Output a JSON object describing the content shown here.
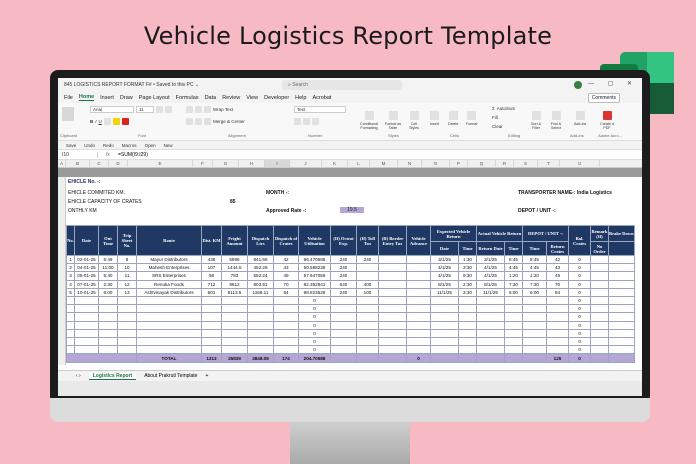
{
  "page_title": "Vehicle Logistics Report Template",
  "window": {
    "title": "845 LOGISTICS REPORT FORMAT F# • Saved to this PC ⌄",
    "search_placeholder": "Search",
    "controls": "— ▢ ✕"
  },
  "menu": {
    "items": [
      "File",
      "Home",
      "Insert",
      "Draw",
      "Page Layout",
      "Formulas",
      "Data",
      "Review",
      "View",
      "Developer",
      "Help",
      "Acrobat"
    ],
    "comments_label": "Comments"
  },
  "ribbon": {
    "font_name": "Arial",
    "font_size": "11",
    "wrap_text": "Wrap Text",
    "merge_center": "Merge & Center",
    "number_format": "Text",
    "conditional_formatting": "Conditional Formatting",
    "format_as_table": "Format as Table",
    "cell_styles": "Cell Styles",
    "insert": "Insert",
    "delete": "Delete",
    "format": "Format",
    "autosum": "AutoSum",
    "fill": "Fill",
    "clear": "Clear",
    "sort_filter": "Sort & Filter",
    "find_select": "Find & Select",
    "add_ins": "Add-ins",
    "create_pdf": "Create a PDF",
    "groups": [
      "Clipboard",
      "Font",
      "Alignment",
      "Number",
      "Styles",
      "Cells",
      "Editing",
      "Add-ins",
      "Adobe Acro..."
    ]
  },
  "quick_access": [
    "Save",
    "Undo",
    "Redo",
    "Macros",
    "Open",
    "New"
  ],
  "formula_bar": {
    "name_box": "I10",
    "formula": "=SUM(I9:I29)"
  },
  "columns": [
    "A",
    "B",
    "C",
    "D",
    "E",
    "F",
    "G",
    "H",
    "I",
    "J",
    "K",
    "L",
    "M",
    "N",
    "O",
    "P",
    "Q",
    "R",
    "S",
    "T",
    "U"
  ],
  "sheet": {
    "vehicle_no": "EHICLE No. -:",
    "committed_km": "EHICLE COMMITED KM.",
    "capacity_crates": "EHICLE CAPACITY OF CRATES",
    "capacity_value": "85",
    "monthly_km": "ONTHLY KM",
    "month_label": "MONTH -:",
    "approved_rate_label": "Approved Rate -:",
    "approved_rate_value": "19.5",
    "transporter": "TRANSPORTER NAME-: India Logistics",
    "depot": "DEPOT / UNIT -:"
  },
  "table": {
    "headers": [
      "No.",
      "Date",
      "Out Time",
      "Trip Sheet No.",
      "Route",
      "Dist. KM",
      "Fright Amount",
      "Dispatch Ltrs",
      "Dispatch of Crates",
      "Vehicle Utilisation",
      "(If) Octroi Exp.",
      "(If) Toll Tax",
      "(If) Border Entry Tax",
      "Vehicle Advance",
      "Expected Vehicle Return",
      "Actual Vehicle Return",
      "DEPOT / UNIT -:",
      "Bal. Crates",
      "Remark (If)",
      "Brake Down"
    ],
    "sub_headers": {
      "expected_date": "Date",
      "expected_time": "Time",
      "actual_date": "Return Date",
      "actual_time": "Time",
      "depot_time": "Time",
      "return_crates": "Return Crates",
      "no_order": "No Order"
    },
    "rows": [
      {
        "no": "1",
        "date": "02-01-25",
        "out": "5:49",
        "trip": "9",
        "route": "Mayur Distributors",
        "km": "436",
        "freight": "5886",
        "ltrs": "841.56",
        "crates": "42",
        "util": "96.470588",
        "octroi": "240",
        "toll": "240",
        "border": "",
        "adv": "",
        "exp_date": "3/1/25",
        "exp_time": "1:30",
        "act_date": "3/1/25",
        "act_time": "8:45",
        "depot_time": "8:45",
        "ret_crates": "42",
        "bal": "0"
      },
      {
        "no": "2",
        "date": "04-01-25",
        "out": "11:00",
        "trip": "10",
        "route": "Mahesh Enterprises",
        "km": "107",
        "freight": "1444.5",
        "ltrs": "452.26",
        "crates": "43",
        "util": "50.588235",
        "octroi": "240",
        "toll": "",
        "border": "",
        "adv": "",
        "exp_date": "4/1/25",
        "exp_time": "3:30",
        "act_date": "4/1/25",
        "act_time": "4:45",
        "depot_time": "4:45",
        "ret_crates": "43",
        "bal": "0"
      },
      {
        "no": "3",
        "date": "05-01-25",
        "out": "5:40",
        "trip": "11",
        "route": "SRS Enterprises",
        "km": "58",
        "freight": "783",
        "ltrs": "552.24",
        "crates": "49",
        "util": "57.647059",
        "octroi": "240",
        "toll": "",
        "border": "",
        "adv": "",
        "exp_date": "4/1/25",
        "exp_time": "9:30",
        "act_date": "4/1/25",
        "act_time": "1:20",
        "depot_time": "1:20",
        "ret_crates": "49",
        "bal": "0"
      },
      {
        "no": "4",
        "date": "07-01-25",
        "out": "2:30",
        "trip": "12",
        "route": "Renuka Foods",
        "km": "712",
        "freight": "9612",
        "ltrs": "803.91",
        "crates": "70",
        "util": "82.352941",
        "octroi": "640",
        "toll": "400",
        "border": "",
        "adv": "",
        "exp_date": "8/1/25",
        "exp_time": "2:30",
        "act_date": "8/1/25",
        "act_time": "7:30",
        "depot_time": "7:30",
        "ret_crates": "70",
        "bal": "0"
      },
      {
        "no": "5",
        "date": "10-01-25",
        "out": "6:00",
        "trip": "13",
        "route": "Ashtvinayak Distributors",
        "km": "601",
        "freight": "8113.5",
        "ltrs": "1168.11",
        "crates": "84",
        "util": "98.823529",
        "octroi": "240",
        "toll": "100",
        "border": "",
        "adv": "",
        "exp_date": "11/1/25",
        "exp_time": "3:30",
        "act_date": "11/1/25",
        "act_time": "6:00",
        "depot_time": "6:00",
        "ret_crates": "84",
        "bal": "0"
      }
    ],
    "empty_util": "0",
    "empty_bal": "0",
    "total": {
      "label": "TOTAL",
      "km": "1313",
      "freight": "25839",
      "ltrs": "3848.08",
      "crates": "174",
      "util": "204.70588",
      "adv": "0",
      "ret_crates": "125",
      "bal": "0"
    }
  },
  "tabs": {
    "active": "Logistics Report",
    "other": "About Prakruti Template",
    "add": "+"
  }
}
